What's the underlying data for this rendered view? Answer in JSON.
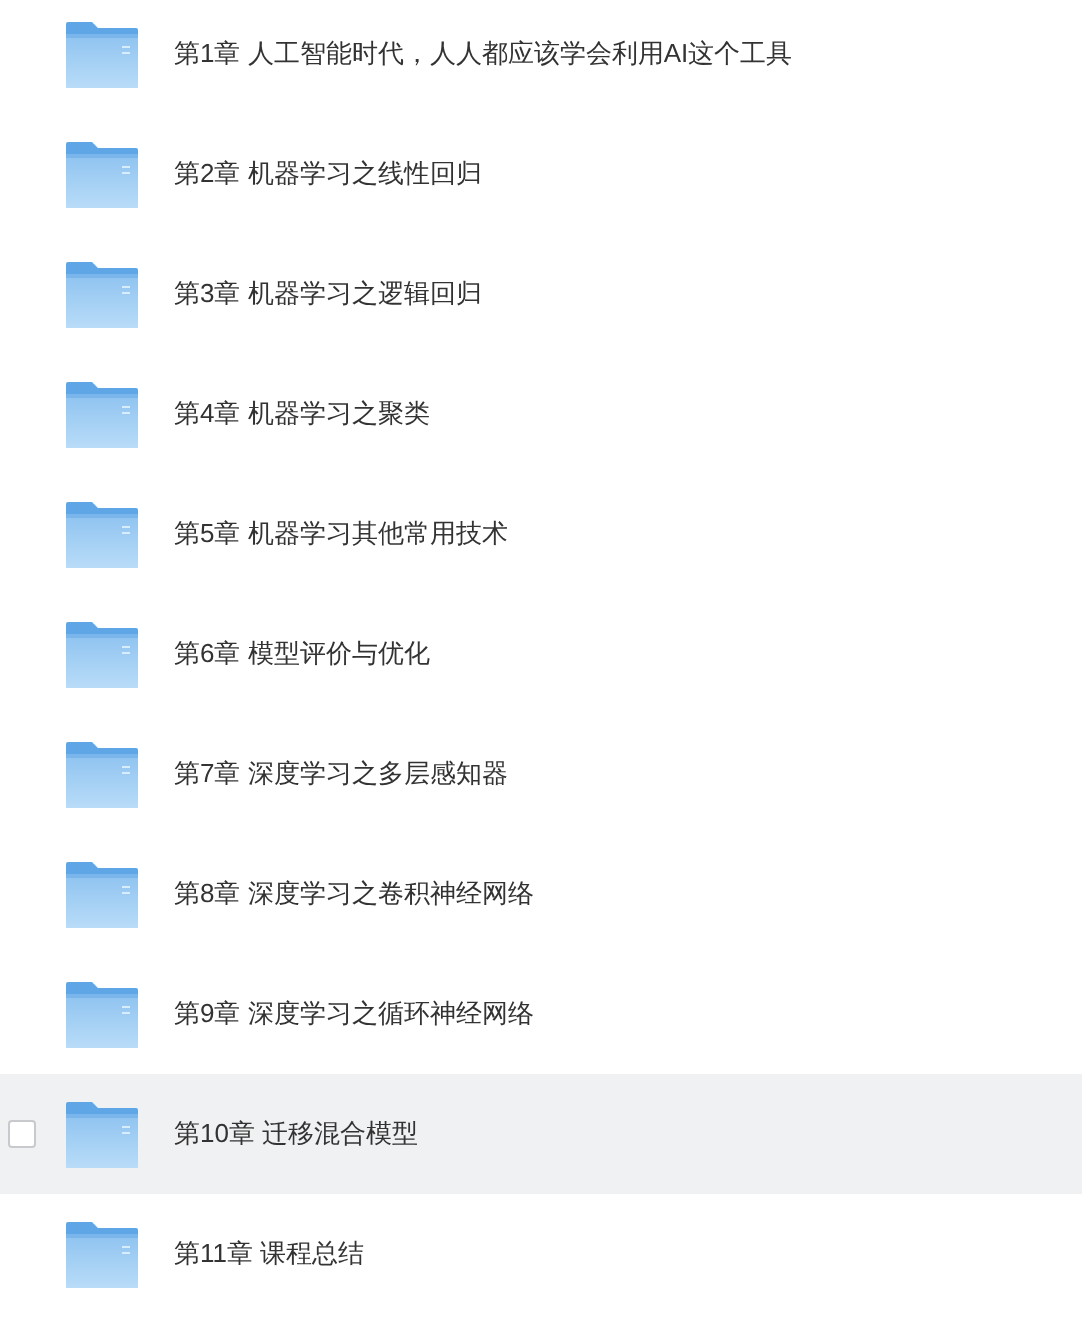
{
  "folders": [
    {
      "name": "第1章 人工智能时代，人人都应该学会利用AI这个工具",
      "hovered": false
    },
    {
      "name": "第2章 机器学习之线性回归",
      "hovered": false
    },
    {
      "name": "第3章 机器学习之逻辑回归",
      "hovered": false
    },
    {
      "name": "第4章 机器学习之聚类",
      "hovered": false
    },
    {
      "name": "第5章 机器学习其他常用技术",
      "hovered": false
    },
    {
      "name": "第6章 模型评价与优化",
      "hovered": false
    },
    {
      "name": "第7章 深度学习之多层感知器",
      "hovered": false
    },
    {
      "name": "第8章 深度学习之卷积神经网络",
      "hovered": false
    },
    {
      "name": "第9章 深度学习之循环神经网络",
      "hovered": false
    },
    {
      "name": "第10章 迁移混合模型",
      "hovered": true
    },
    {
      "name": "第11章 课程总结",
      "hovered": false
    }
  ]
}
